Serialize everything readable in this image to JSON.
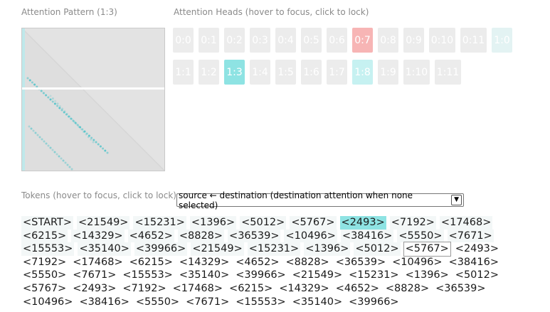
{
  "pattern": {
    "title": "Attention Pattern (1:3)"
  },
  "heads": {
    "title": "Attention Heads (hover to focus, click to lock)",
    "row1": [
      {
        "label": "0:0",
        "state": "none"
      },
      {
        "label": "0:1",
        "state": "none"
      },
      {
        "label": "0:2",
        "state": "none"
      },
      {
        "label": "0:3",
        "state": "none"
      },
      {
        "label": "0:4",
        "state": "none"
      },
      {
        "label": "0:5",
        "state": "none"
      },
      {
        "label": "0:6",
        "state": "none"
      },
      {
        "label": "0:7",
        "state": "red"
      },
      {
        "label": "0:8",
        "state": "none"
      },
      {
        "label": "0:9",
        "state": "none"
      },
      {
        "label": "0:10",
        "state": "none"
      },
      {
        "label": "0:11",
        "state": "none"
      },
      {
        "label": "1:0",
        "state": "faint-teal"
      }
    ],
    "row2": [
      {
        "label": "1:1",
        "state": "none"
      },
      {
        "label": "1:2",
        "state": "none"
      },
      {
        "label": "1:3",
        "state": "teal"
      },
      {
        "label": "1:4",
        "state": "none"
      },
      {
        "label": "1:5",
        "state": "none"
      },
      {
        "label": "1:6",
        "state": "none"
      },
      {
        "label": "1:7",
        "state": "none"
      },
      {
        "label": "1:8",
        "state": "light-teal"
      },
      {
        "label": "1:9",
        "state": "none"
      },
      {
        "label": "1:10",
        "state": "none"
      },
      {
        "label": "1:11",
        "state": "none"
      }
    ]
  },
  "tokens_section": {
    "title": "Tokens (hover to focus, click to lock)",
    "select_value": "source ← destination (destination attention when none selected)"
  },
  "tokens": [
    {
      "text": "<START>",
      "hl": "faint"
    },
    {
      "text": "<21549>",
      "hl": "faint"
    },
    {
      "text": "<15231>",
      "hl": "faint"
    },
    {
      "text": "<1396>",
      "hl": "faint"
    },
    {
      "text": "<5012>",
      "hl": "faint"
    },
    {
      "text": "<5767>",
      "hl": "faint"
    },
    {
      "text": "<2493>",
      "hl": "strong"
    },
    {
      "text": "<7192>",
      "hl": "faint"
    },
    {
      "text": "<17468>",
      "hl": "faint"
    },
    {
      "text": "<6215>",
      "hl": "faint"
    },
    {
      "text": "<14329>",
      "hl": "faint"
    },
    {
      "text": "<4652>",
      "hl": "faint"
    },
    {
      "text": "<8828>",
      "hl": "faint"
    },
    {
      "text": "<36539>",
      "hl": "faint"
    },
    {
      "text": "<10496>",
      "hl": "faint"
    },
    {
      "text": "<38416>",
      "hl": "faint"
    },
    {
      "text": "<5550>",
      "hl": "faint"
    },
    {
      "text": "<7671>",
      "hl": "faint"
    },
    {
      "text": "<15553>",
      "hl": "faint"
    },
    {
      "text": "<35140>",
      "hl": "faint"
    },
    {
      "text": "<39966>",
      "hl": "faint"
    },
    {
      "text": "<21549>",
      "hl": "faint"
    },
    {
      "text": "<15231>",
      "hl": "faint"
    },
    {
      "text": "<1396>",
      "hl": "faint"
    },
    {
      "text": "<5012>",
      "hl": "faint"
    },
    {
      "text": "<5767>",
      "hl": "focused"
    },
    {
      "text": "<2493>",
      "hl": "none"
    },
    {
      "text": "<7192>",
      "hl": "none"
    },
    {
      "text": "<17468>",
      "hl": "none"
    },
    {
      "text": "<6215>",
      "hl": "none"
    },
    {
      "text": "<14329>",
      "hl": "none"
    },
    {
      "text": "<4652>",
      "hl": "none"
    },
    {
      "text": "<8828>",
      "hl": "none"
    },
    {
      "text": "<36539>",
      "hl": "none"
    },
    {
      "text": "<10496>",
      "hl": "none"
    },
    {
      "text": "<38416>",
      "hl": "none"
    },
    {
      "text": "<5550>",
      "hl": "none"
    },
    {
      "text": "<7671>",
      "hl": "none"
    },
    {
      "text": "<15553>",
      "hl": "none"
    },
    {
      "text": "<35140>",
      "hl": "none"
    },
    {
      "text": "<39966>",
      "hl": "none"
    },
    {
      "text": "<21549>",
      "hl": "none"
    },
    {
      "text": "<15231>",
      "hl": "none"
    },
    {
      "text": "<1396>",
      "hl": "none"
    },
    {
      "text": "<5012>",
      "hl": "none"
    },
    {
      "text": "<5767>",
      "hl": "none"
    },
    {
      "text": "<2493>",
      "hl": "none"
    },
    {
      "text": "<7192>",
      "hl": "none"
    },
    {
      "text": "<17468>",
      "hl": "none"
    },
    {
      "text": "<6215>",
      "hl": "none"
    },
    {
      "text": "<14329>",
      "hl": "none"
    },
    {
      "text": "<4652>",
      "hl": "none"
    },
    {
      "text": "<8828>",
      "hl": "none"
    },
    {
      "text": "<36539>",
      "hl": "none"
    },
    {
      "text": "<10496>",
      "hl": "none"
    },
    {
      "text": "<38416>",
      "hl": "none"
    },
    {
      "text": "<5550>",
      "hl": "none"
    },
    {
      "text": "<7671>",
      "hl": "none"
    },
    {
      "text": "<15553>",
      "hl": "none"
    },
    {
      "text": "<35140>",
      "hl": "none"
    },
    {
      "text": "<39966>",
      "hl": "none"
    }
  ],
  "colors": {
    "teal": "#8ee3e3",
    "light_teal": "#c6f1f1",
    "faint_teal": "#e3f3f3",
    "red": "#f7b5b5",
    "inactive": "#ececec",
    "token_faint": "#f3f7f7",
    "token_strong": "#8ee3e3",
    "pattern_bg": "#e3e3e3",
    "pattern_dot": "#4cc3c9"
  }
}
